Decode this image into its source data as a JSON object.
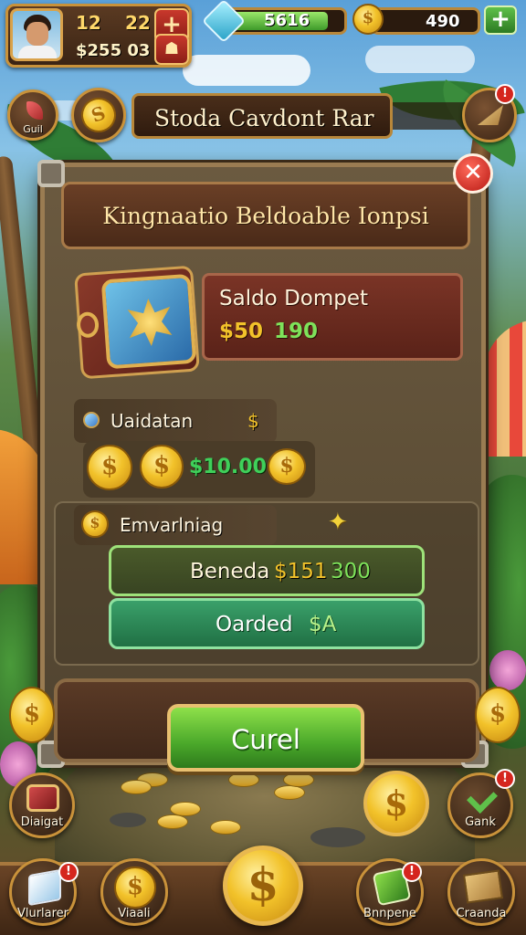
{
  "colors": {
    "accent_gold": "#c9923a",
    "panel_brown": "#5d4e36",
    "green_cta": "#4aa82a",
    "green_value": "#3fd05a",
    "gold_value": "#f2c22a",
    "red_alert": "#d5261e"
  },
  "hud": {
    "level": "12",
    "energy": "22",
    "player_money": "$255 03",
    "add_label": "+",
    "gems_value": "5616",
    "gems_bar_fill": 0.88,
    "coins_value": "490",
    "add_coins_label": "+",
    "icons": {
      "avatar": "player-avatar",
      "gem": "gem-icon",
      "coin": "coin-icon"
    }
  },
  "subbar": {
    "left_button_label": "Guil",
    "title": "Stoda Cavdont Rar",
    "alert_badge": "!"
  },
  "dialog": {
    "title": "Kingnaatio Beldoable Ionpsi",
    "close_label": "✕",
    "wallet": {
      "label": "Saldo Dompet",
      "amount_prefix": "$50",
      "amount_value": "190"
    },
    "validation": {
      "label": "Uaidatan",
      "label_suffix": "$",
      "amount": "$10.00"
    },
    "earnings": {
      "label": "Emvarlniag"
    },
    "options": [
      {
        "label": "Beneda",
        "price": "$151",
        "bonus": "300"
      },
      {
        "label": "Oarded",
        "price": "$A"
      }
    ],
    "confirm_label": "Curel"
  },
  "side_actions": {
    "left_label": "Diaigat",
    "right_label": "Gank",
    "right_badge": "!",
    "coin_symbol": "$"
  },
  "bottom_nav": [
    {
      "label": "Vlurlarer",
      "icon": "cube-icon",
      "badge": "!"
    },
    {
      "label": "Viaali",
      "icon": "coin-icon"
    },
    {
      "label": "",
      "icon": "dollar-coin-icon"
    },
    {
      "label": "Bnnpene",
      "icon": "gift-icon",
      "badge": "!"
    },
    {
      "label": "Craanda",
      "icon": "map-icon"
    }
  ]
}
